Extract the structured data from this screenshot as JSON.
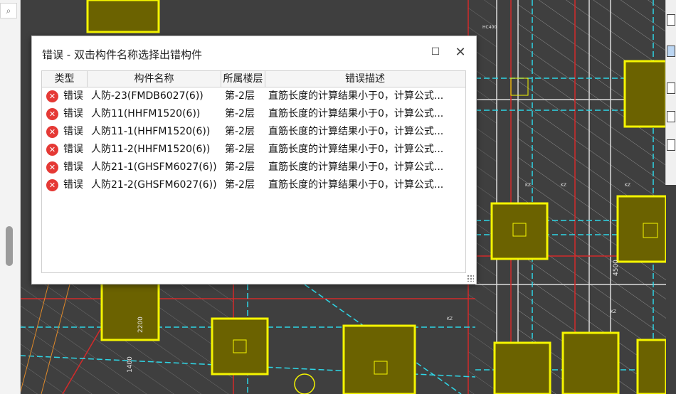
{
  "search": {
    "icon": "search-icon"
  },
  "dialog": {
    "title": "错误 - 双击构件名称选择出错构件",
    "buttons": {
      "maximize": "☐",
      "close": "✕"
    }
  },
  "table": {
    "columns": [
      "类型",
      "构件名称",
      "所属楼层",
      "错误描述"
    ],
    "rows": [
      {
        "type": "错误",
        "name": "人防-23(FMDB6027(6))",
        "floor": "第-2层",
        "desc": "直筋长度的计算结果小于0，计算公式..."
      },
      {
        "type": "错误",
        "name": "人防11(HHFM1520(6))",
        "floor": "第-2层",
        "desc": "直筋长度的计算结果小于0，计算公式..."
      },
      {
        "type": "错误",
        "name": "人防11-1(HHFM1520(6))",
        "floor": "第-2层",
        "desc": "直筋长度的计算结果小于0，计算公式..."
      },
      {
        "type": "错误",
        "name": "人防11-2(HHFM1520(6))",
        "floor": "第-2层",
        "desc": "直筋长度的计算结果小于0，计算公式..."
      },
      {
        "type": "错误",
        "name": "人防21-1(GHSFM6027(6))",
        "floor": "第-2层",
        "desc": "直筋长度的计算结果小于0，计算公式..."
      },
      {
        "type": "错误",
        "name": "人防21-2(GHSFM6027(6))",
        "floor": "第-2层",
        "desc": "直筋长度的计算结果小于0，计算公式..."
      }
    ]
  },
  "cad_labels": [
    "2200",
    "1400",
    "4500"
  ],
  "colors": {
    "cad_bg": "#3f3f3f",
    "column_fill": "#6b6200",
    "column_border": "#f5f500",
    "grid_line": "#e0e0e0",
    "red_line": "#d42a2a",
    "cyan_line": "#2fd6e6",
    "hatch": "#8a8a8a",
    "error_icon": "#e53935"
  }
}
